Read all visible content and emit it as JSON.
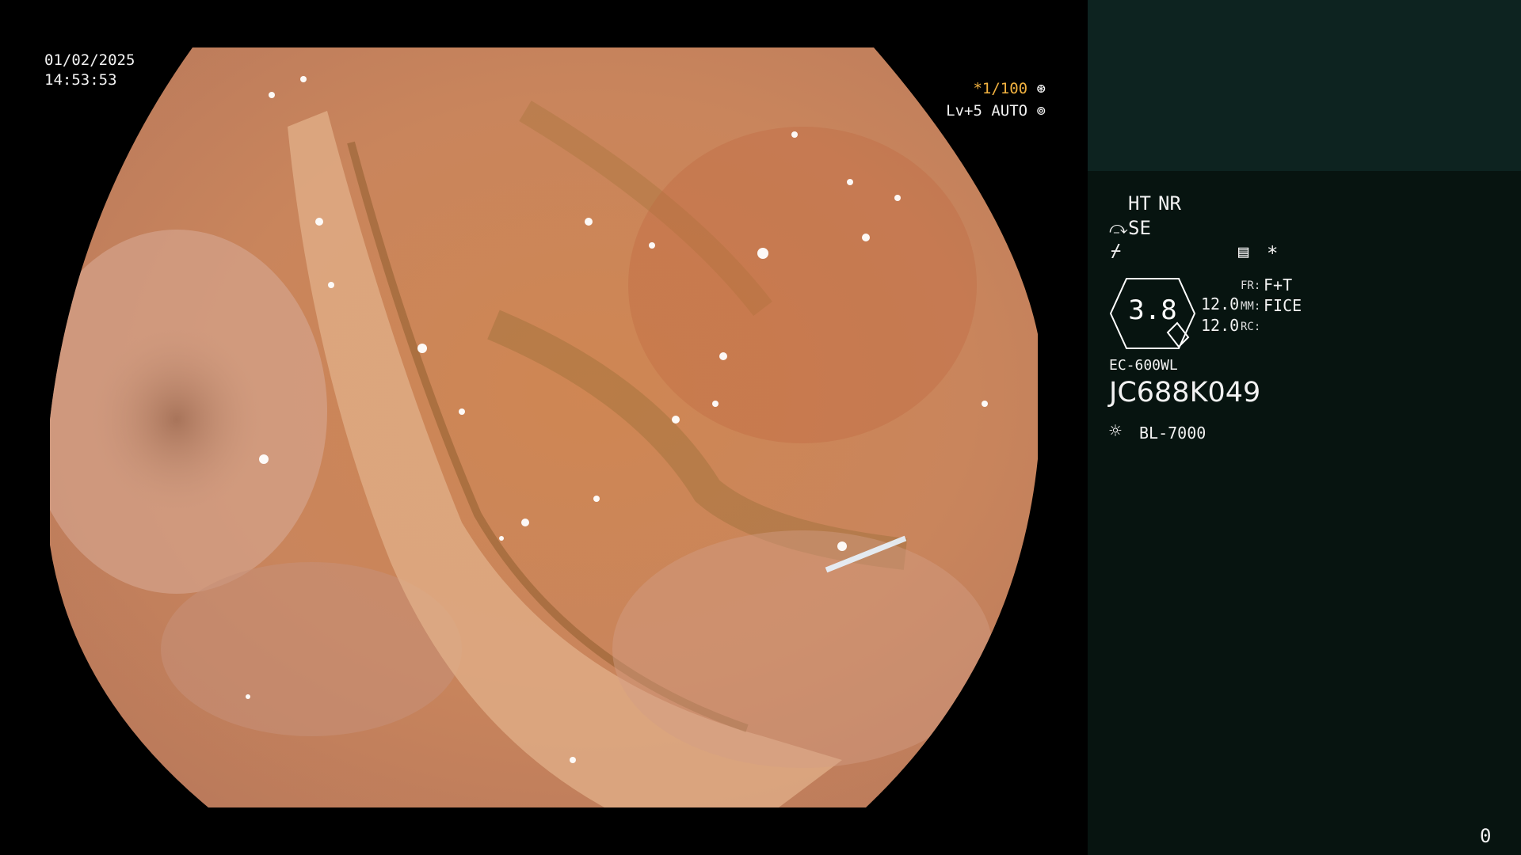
{
  "overlay": {
    "date": "01/02/2025",
    "time": "14:53:53",
    "shutter": "*1/100",
    "level": "Lv+5 AUTO"
  },
  "sidebar": {
    "ht": "HT",
    "nr": "NR",
    "se": "SE",
    "gauge_value": "3.8",
    "val1": "12.0",
    "val2": "12.0",
    "fr_label": "FR:",
    "fr_value": "F+T",
    "mm_label": "MM:",
    "mm_value": "FICE",
    "rc_label": "RC:",
    "scope_model": "EC-600WL",
    "serial": "JC688K049",
    "light_source": "BL-7000",
    "asterisk": "*",
    "counter": "0"
  },
  "colors": {
    "amber": "#f2b240",
    "sidebar_bg": "#071410",
    "sidebar_top_bg": "#0d2320"
  },
  "icons": [
    "shutter-wheel-icon",
    "iris-icon",
    "scope-tip-icon",
    "freeze-icon",
    "memo-icon",
    "lamp-icon"
  ]
}
